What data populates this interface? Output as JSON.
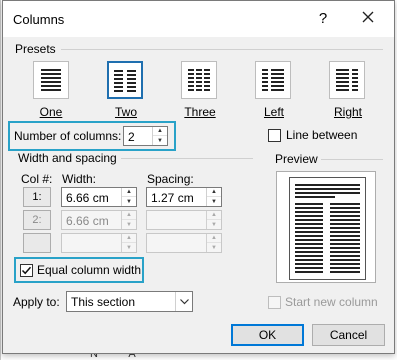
{
  "dialog": {
    "title": "Columns",
    "help": "?",
    "close": "✕"
  },
  "presets": {
    "group_label": "Presets",
    "items": [
      {
        "label": "One",
        "columns": 1,
        "selected": false
      },
      {
        "label": "Two",
        "columns": 2,
        "selected": true
      },
      {
        "label": "Three",
        "columns": 3,
        "selected": false
      },
      {
        "label": "Left",
        "columns": "left",
        "selected": false
      },
      {
        "label": "Right",
        "columns": "right",
        "selected": false
      }
    ]
  },
  "number_of_columns": {
    "label": "Number of columns:",
    "value": "2"
  },
  "line_between": {
    "label": "Line between",
    "checked": false
  },
  "width_spacing": {
    "group_label": "Width and spacing",
    "col_header": "Col #:",
    "width_header": "Width:",
    "spacing_header": "Spacing:",
    "rows": [
      {
        "col": "1:",
        "width": "6.66 cm",
        "spacing": "1.27 cm",
        "enabled": true
      },
      {
        "col": "2:",
        "width": "6.66 cm",
        "spacing": "",
        "enabled": false
      },
      {
        "col": "",
        "width": "",
        "spacing": "",
        "enabled": false
      }
    ]
  },
  "preview": {
    "label": "Preview"
  },
  "equal_column_width": {
    "label": "Equal column width",
    "checked": true
  },
  "apply_to": {
    "label": "Apply to:",
    "value": "This section"
  },
  "start_new_column": {
    "label": "Start new column",
    "checked": false
  },
  "buttons": {
    "ok": "OK",
    "cancel": "Cancel"
  },
  "background": {
    "bottom_text": "N A"
  },
  "colors": {
    "highlight": "#29a2c8",
    "default_button_border": "#0078d7",
    "selected_preset_border": "#1f6faf"
  }
}
